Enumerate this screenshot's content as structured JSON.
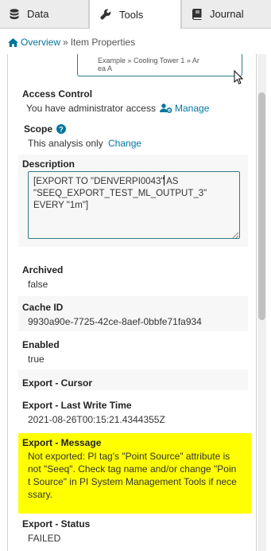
{
  "tabs": [
    {
      "label": "Data",
      "icon": "database-icon"
    },
    {
      "label": "Tools",
      "icon": "wrench-icon",
      "active": true
    },
    {
      "label": "Journal",
      "icon": "book-icon"
    }
  ],
  "breadcrumb": {
    "home": "Overview",
    "separator": "»",
    "current": "Item Properties"
  },
  "asset_path": {
    "line1": "Example » Cooling Tower 1 » Ar",
    "line2": "ea A"
  },
  "access_control": {
    "label": "Access Control",
    "text": "You have administrator access",
    "link": "Manage"
  },
  "scope": {
    "label": "Scope",
    "text": "This analysis only",
    "link": "Change"
  },
  "description": {
    "label": "Description",
    "value": "[EXPORT TO \"DENVERPI0043\" AS\n\"SEEQ_EXPORT_TEST_ML_OUTPUT_3\"\nEVERY \"1m\"]"
  },
  "properties": [
    {
      "label": "Archived",
      "value": "false"
    },
    {
      "label": "Cache ID",
      "value": "9930a90e-7725-42ce-8aef-0bbfe71fa934"
    },
    {
      "label": "Enabled",
      "value": "true"
    },
    {
      "label": "Export - Cursor",
      "value": ""
    },
    {
      "label": "Export - Last Write Time",
      "value": "2021-08-26T00:15:21.4344355Z"
    },
    {
      "label": "Export - Message",
      "value_lines": [
        "Not exported: PI tag's \"Point Source\" attribute is",
        "not \"Seeq\". Check tag name and/or change \"Poin",
        "t Source\" in PI System Management Tools if nece",
        "ssary."
      ]
    },
    {
      "label": "Export - Status",
      "value": "FAILED"
    }
  ],
  "colors": {
    "link": "#00769e",
    "highlight": "#ffff00",
    "border_accent": "#2f7a8c"
  }
}
